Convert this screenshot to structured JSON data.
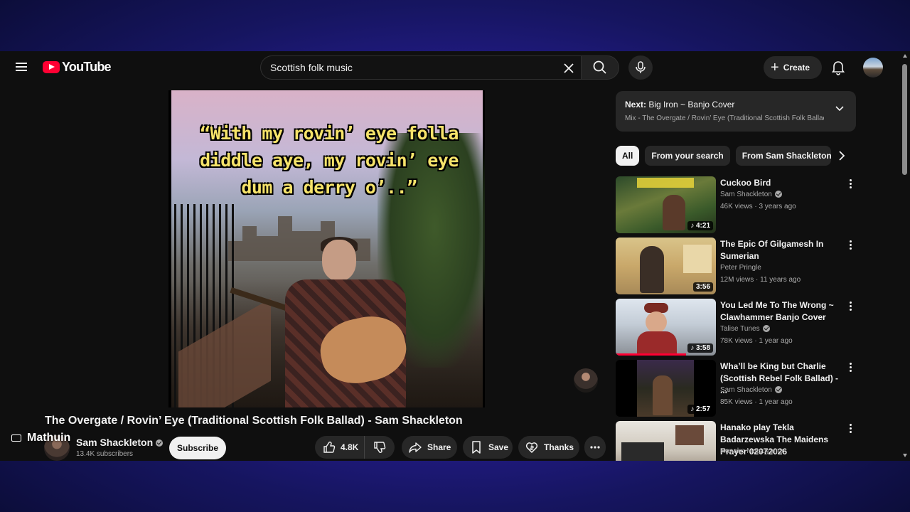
{
  "header": {
    "logo_text": "YouTube",
    "search_value": "Scottish folk music",
    "create_label": "Create"
  },
  "video": {
    "lyrics": "“With my rovin’ eye folla diddle aye, my rovin’ eye dum a derry o’..”",
    "title": "The Overgate / Rovin’ Eye (Traditional Scottish Folk Ballad) - Sam Shackleton",
    "channel": "Sam Shackleton",
    "subscribers": "13.4K subscribers",
    "subscribe_label": "Subscribe",
    "overlay_name": "Mathuin"
  },
  "actions": {
    "likes": "4.8K",
    "share": "Share",
    "save": "Save",
    "thanks": "Thanks"
  },
  "next": {
    "label": "Next:",
    "title": "Big Iron ~ Banjo Cover",
    "subtitle": "Mix - The Overgate / Rovin’ Eye (Traditional Scottish Folk Ballad)"
  },
  "chips": [
    "All",
    "From your search",
    "From Sam Shackleton"
  ],
  "recommendations": [
    {
      "title": "Cuckoo Bird",
      "channel": "Sam Shackleton",
      "verified": true,
      "meta": "46K views · 3 years ago",
      "duration": "4:21",
      "music": true
    },
    {
      "title": "The Epic Of Gilgamesh In Sumerian",
      "channel": "Peter Pringle",
      "verified": false,
      "meta": "12M views · 11 years ago",
      "duration": "3:56",
      "music": false
    },
    {
      "title": "You Led Me To The Wrong ~ Clawhammer Banjo Cover",
      "channel": "Talise Tunes",
      "verified": true,
      "meta": "78K views · 1 year ago",
      "duration": "3:58",
      "music": true,
      "watched_fraction": 0.7
    },
    {
      "title": "Wha’ll be King but Charlie (Scottish Rebel Folk Ballad) - ...",
      "channel": "Sam Shackleton",
      "verified": true,
      "meta": "85K views · 1 year ago",
      "duration": "2:57",
      "music": true
    },
    {
      "title": "Hanako play Tekla Badarzewska The Maidens Prayer 02072026",
      "channel": "Hanako Matsuyama",
      "verified": false,
      "meta": "",
      "duration": "",
      "music": false
    }
  ],
  "colors": {
    "accent_red": "#ff0033",
    "background": "#0f0f0f",
    "pill": "#272727",
    "lyric_yellow": "#f6e36a"
  }
}
